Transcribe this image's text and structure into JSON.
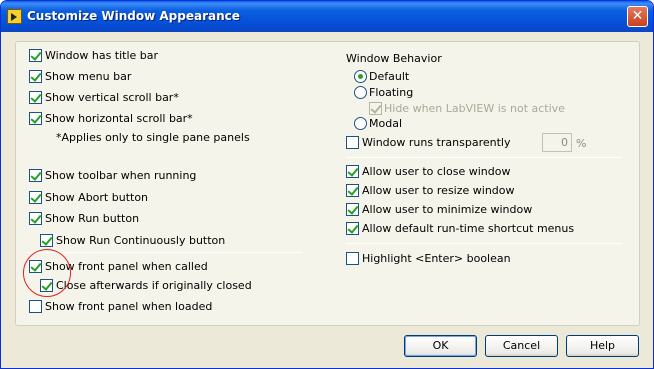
{
  "window": {
    "title": "Customize Window Appearance",
    "close_glyph": "✕"
  },
  "left": {
    "window_has_title_bar": {
      "label": "Window has title bar",
      "checked": true
    },
    "show_menu_bar": {
      "label": "Show menu bar",
      "checked": true
    },
    "show_vertical_scroll": {
      "label": "Show vertical scroll bar*",
      "checked": true
    },
    "show_horizontal_scroll": {
      "label": "Show horizontal scroll bar*",
      "checked": true
    },
    "note": "*Applies only to single pane panels",
    "show_toolbar": {
      "label": "Show toolbar when running",
      "checked": true
    },
    "show_abort": {
      "label": "Show Abort button",
      "checked": true
    },
    "show_run": {
      "label": "Show Run button",
      "checked": true
    },
    "show_run_continuously": {
      "label": "Show Run Continuously button",
      "checked": true
    },
    "show_front_panel_called": {
      "label": "Show front panel when called",
      "checked": true
    },
    "close_afterwards": {
      "label": "Close afterwards if originally closed",
      "checked": true
    },
    "show_front_panel_loaded": {
      "label": "Show front panel when loaded",
      "checked": false
    }
  },
  "right": {
    "behavior_heading": "Window Behavior",
    "default": {
      "label": "Default",
      "selected": true
    },
    "floating": {
      "label": "Floating",
      "selected": false
    },
    "hide_when_inactive": {
      "label": "Hide when LabVIEW is not active",
      "checked": true,
      "disabled": true
    },
    "modal": {
      "label": "Modal",
      "selected": false
    },
    "transparent": {
      "label": "Window runs transparently",
      "checked": false
    },
    "transparency_value": "0",
    "percent_sign": "%",
    "allow_close": {
      "label": "Allow user to close window",
      "checked": true
    },
    "allow_resize": {
      "label": "Allow user to resize window",
      "checked": true
    },
    "allow_minimize": {
      "label": "Allow user to minimize window",
      "checked": true
    },
    "allow_shortcut_menus": {
      "label": "Allow default run-time shortcut menus",
      "checked": true
    },
    "highlight_enter": {
      "label": "Highlight <Enter> boolean",
      "checked": false
    }
  },
  "buttons": {
    "ok": "OK",
    "cancel": "Cancel",
    "help": "Help"
  }
}
